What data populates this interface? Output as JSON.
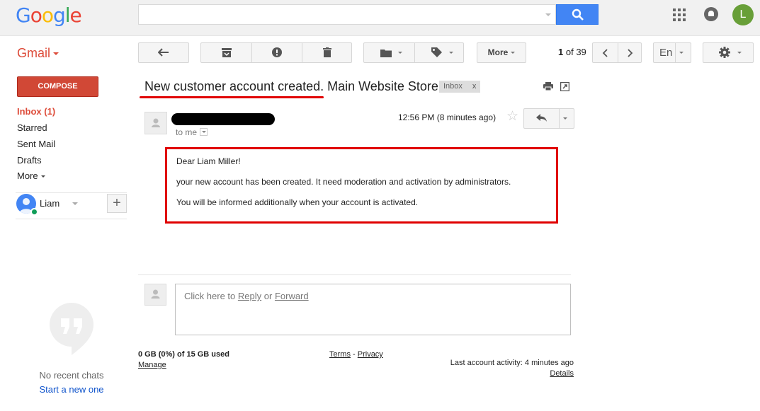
{
  "header": {
    "logo_letters": [
      "G",
      "o",
      "o",
      "g",
      "l",
      "e"
    ],
    "search": {
      "value": "",
      "placeholder": ""
    },
    "account_initial": "L",
    "icons": [
      "search-icon",
      "apps-grid-icon",
      "notifications-bell-icon"
    ]
  },
  "toolbar": {
    "app_label": "Gmail",
    "more_label": "More",
    "pager": {
      "current": "1",
      "of_label": "of",
      "total": "39"
    },
    "input_tool_label": "En",
    "icons": [
      "back-arrow-icon",
      "archive-icon",
      "report-spam-icon",
      "delete-icon",
      "folder-icon",
      "label-tag-icon",
      "chevron-left-icon",
      "chevron-right-icon",
      "gear-icon"
    ]
  },
  "sidebar": {
    "compose_label": "COMPOSE",
    "items": [
      {
        "label": "Inbox (1)",
        "active": true
      },
      {
        "label": "Starred",
        "active": false
      },
      {
        "label": "Sent Mail",
        "active": false
      },
      {
        "label": "Drafts",
        "active": false
      },
      {
        "label": "More",
        "active": false
      }
    ],
    "hangouts_user": "Liam",
    "no_chats": "No recent chats",
    "start_new": "Start a new one"
  },
  "message": {
    "subject": "New customer account created. Main Website Store",
    "label_chip": "Inbox",
    "label_chip_close": "x",
    "to_me": "to me",
    "timestamp": "12:56 PM (8 minutes ago)",
    "body": [
      "Dear Liam Miller!",
      "your new account has been created. It need moderation and activation by administrators.",
      "You will be informed additionally when your account is activated."
    ],
    "accent_color": "#e00000"
  },
  "reply_prompt": {
    "prefix": "Click here to",
    "reply": "Reply",
    "or": "or",
    "forward": "Forward"
  },
  "footer": {
    "usage": "0 GB (0%) of 15 GB used",
    "manage": "Manage",
    "terms": "Terms",
    "separator": "-",
    "privacy": "Privacy",
    "last_activity": "Last account activity: 4 minutes ago",
    "details": "Details"
  },
  "colors": {
    "gmail_red": "#dd4b39",
    "compose_red": "#d14836",
    "search_blue": "#4285f4",
    "avatar_green": "#689f38"
  }
}
